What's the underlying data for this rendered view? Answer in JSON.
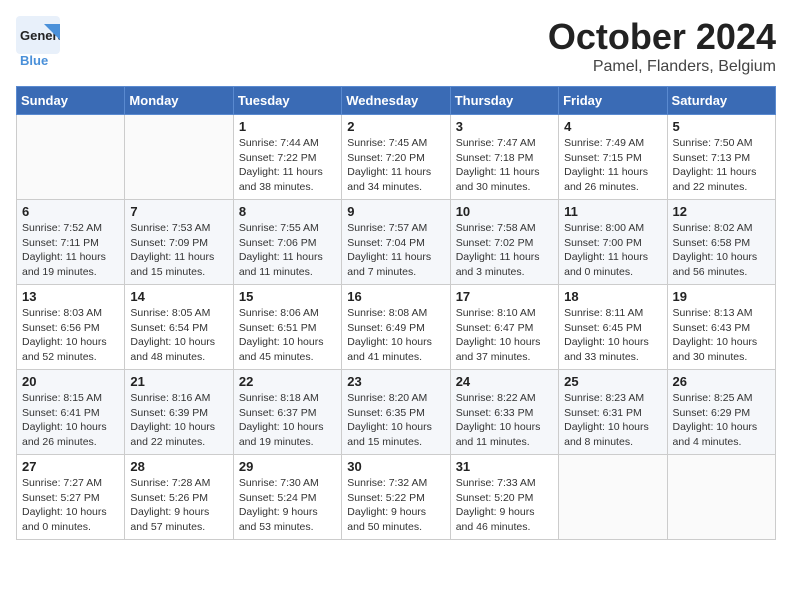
{
  "header": {
    "logo_general": "General",
    "logo_blue": "Blue",
    "month_title": "October 2024",
    "location": "Pamel, Flanders, Belgium"
  },
  "weekdays": [
    "Sunday",
    "Monday",
    "Tuesday",
    "Wednesday",
    "Thursday",
    "Friday",
    "Saturday"
  ],
  "weeks": [
    [
      {
        "day": "",
        "info": ""
      },
      {
        "day": "",
        "info": ""
      },
      {
        "day": "1",
        "info": "Sunrise: 7:44 AM\nSunset: 7:22 PM\nDaylight: 11 hours\nand 38 minutes."
      },
      {
        "day": "2",
        "info": "Sunrise: 7:45 AM\nSunset: 7:20 PM\nDaylight: 11 hours\nand 34 minutes."
      },
      {
        "day": "3",
        "info": "Sunrise: 7:47 AM\nSunset: 7:18 PM\nDaylight: 11 hours\nand 30 minutes."
      },
      {
        "day": "4",
        "info": "Sunrise: 7:49 AM\nSunset: 7:15 PM\nDaylight: 11 hours\nand 26 minutes."
      },
      {
        "day": "5",
        "info": "Sunrise: 7:50 AM\nSunset: 7:13 PM\nDaylight: 11 hours\nand 22 minutes."
      }
    ],
    [
      {
        "day": "6",
        "info": "Sunrise: 7:52 AM\nSunset: 7:11 PM\nDaylight: 11 hours\nand 19 minutes."
      },
      {
        "day": "7",
        "info": "Sunrise: 7:53 AM\nSunset: 7:09 PM\nDaylight: 11 hours\nand 15 minutes."
      },
      {
        "day": "8",
        "info": "Sunrise: 7:55 AM\nSunset: 7:06 PM\nDaylight: 11 hours\nand 11 minutes."
      },
      {
        "day": "9",
        "info": "Sunrise: 7:57 AM\nSunset: 7:04 PM\nDaylight: 11 hours\nand 7 minutes."
      },
      {
        "day": "10",
        "info": "Sunrise: 7:58 AM\nSunset: 7:02 PM\nDaylight: 11 hours\nand 3 minutes."
      },
      {
        "day": "11",
        "info": "Sunrise: 8:00 AM\nSunset: 7:00 PM\nDaylight: 11 hours\nand 0 minutes."
      },
      {
        "day": "12",
        "info": "Sunrise: 8:02 AM\nSunset: 6:58 PM\nDaylight: 10 hours\nand 56 minutes."
      }
    ],
    [
      {
        "day": "13",
        "info": "Sunrise: 8:03 AM\nSunset: 6:56 PM\nDaylight: 10 hours\nand 52 minutes."
      },
      {
        "day": "14",
        "info": "Sunrise: 8:05 AM\nSunset: 6:54 PM\nDaylight: 10 hours\nand 48 minutes."
      },
      {
        "day": "15",
        "info": "Sunrise: 8:06 AM\nSunset: 6:51 PM\nDaylight: 10 hours\nand 45 minutes."
      },
      {
        "day": "16",
        "info": "Sunrise: 8:08 AM\nSunset: 6:49 PM\nDaylight: 10 hours\nand 41 minutes."
      },
      {
        "day": "17",
        "info": "Sunrise: 8:10 AM\nSunset: 6:47 PM\nDaylight: 10 hours\nand 37 minutes."
      },
      {
        "day": "18",
        "info": "Sunrise: 8:11 AM\nSunset: 6:45 PM\nDaylight: 10 hours\nand 33 minutes."
      },
      {
        "day": "19",
        "info": "Sunrise: 8:13 AM\nSunset: 6:43 PM\nDaylight: 10 hours\nand 30 minutes."
      }
    ],
    [
      {
        "day": "20",
        "info": "Sunrise: 8:15 AM\nSunset: 6:41 PM\nDaylight: 10 hours\nand 26 minutes."
      },
      {
        "day": "21",
        "info": "Sunrise: 8:16 AM\nSunset: 6:39 PM\nDaylight: 10 hours\nand 22 minutes."
      },
      {
        "day": "22",
        "info": "Sunrise: 8:18 AM\nSunset: 6:37 PM\nDaylight: 10 hours\nand 19 minutes."
      },
      {
        "day": "23",
        "info": "Sunrise: 8:20 AM\nSunset: 6:35 PM\nDaylight: 10 hours\nand 15 minutes."
      },
      {
        "day": "24",
        "info": "Sunrise: 8:22 AM\nSunset: 6:33 PM\nDaylight: 10 hours\nand 11 minutes."
      },
      {
        "day": "25",
        "info": "Sunrise: 8:23 AM\nSunset: 6:31 PM\nDaylight: 10 hours\nand 8 minutes."
      },
      {
        "day": "26",
        "info": "Sunrise: 8:25 AM\nSunset: 6:29 PM\nDaylight: 10 hours\nand 4 minutes."
      }
    ],
    [
      {
        "day": "27",
        "info": "Sunrise: 7:27 AM\nSunset: 5:27 PM\nDaylight: 10 hours\nand 0 minutes."
      },
      {
        "day": "28",
        "info": "Sunrise: 7:28 AM\nSunset: 5:26 PM\nDaylight: 9 hours\nand 57 minutes."
      },
      {
        "day": "29",
        "info": "Sunrise: 7:30 AM\nSunset: 5:24 PM\nDaylight: 9 hours\nand 53 minutes."
      },
      {
        "day": "30",
        "info": "Sunrise: 7:32 AM\nSunset: 5:22 PM\nDaylight: 9 hours\nand 50 minutes."
      },
      {
        "day": "31",
        "info": "Sunrise: 7:33 AM\nSunset: 5:20 PM\nDaylight: 9 hours\nand 46 minutes."
      },
      {
        "day": "",
        "info": ""
      },
      {
        "day": "",
        "info": ""
      }
    ]
  ]
}
